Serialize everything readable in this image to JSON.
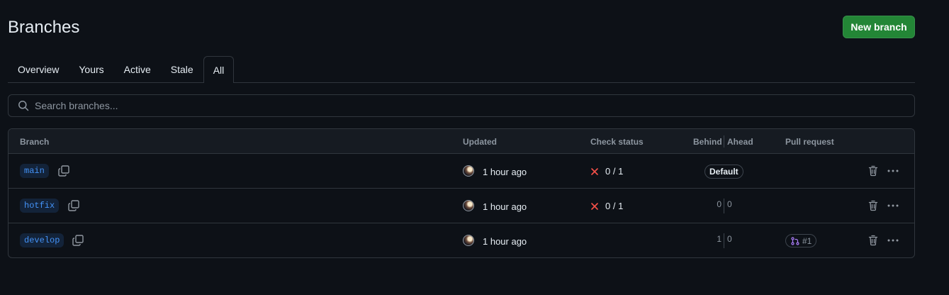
{
  "header": {
    "title": "Branches",
    "new_branch_label": "New branch"
  },
  "tabs": [
    {
      "label": "Overview"
    },
    {
      "label": "Yours"
    },
    {
      "label": "Active"
    },
    {
      "label": "Stale"
    },
    {
      "label": "All"
    }
  ],
  "selected_tab": "All",
  "search": {
    "placeholder": "Search branches...",
    "value": ""
  },
  "table": {
    "columns": {
      "branch": "Branch",
      "updated": "Updated",
      "check_status": "Check status",
      "behind": "Behind",
      "ahead": "Ahead",
      "pull_request": "Pull request"
    },
    "rows": [
      {
        "name": "main",
        "updated": "1 hour ago",
        "check": "0 / 1",
        "default_label": "Default",
        "behind": "",
        "ahead": "",
        "pr": ""
      },
      {
        "name": "hotfix",
        "updated": "1 hour ago",
        "check": "0 / 1",
        "default_label": "",
        "behind": "0",
        "ahead": "0",
        "pr": ""
      },
      {
        "name": "develop",
        "updated": "1 hour ago",
        "check": "",
        "default_label": "",
        "behind": "1",
        "ahead": "0",
        "pr": "#1"
      }
    ]
  },
  "icons": {
    "search": "search-icon",
    "copy": "copy-icon",
    "fail": "x-icon",
    "pr": "git-pull-request-icon",
    "trash": "trash-icon",
    "more": "kebab-horizontal-icon"
  },
  "colors": {
    "background": "#0d1117",
    "accent_green": "#238636",
    "link_blue": "#4493f8",
    "fail_red": "#f85149",
    "pr_purple": "#ab7df8",
    "border": "#30363d"
  }
}
